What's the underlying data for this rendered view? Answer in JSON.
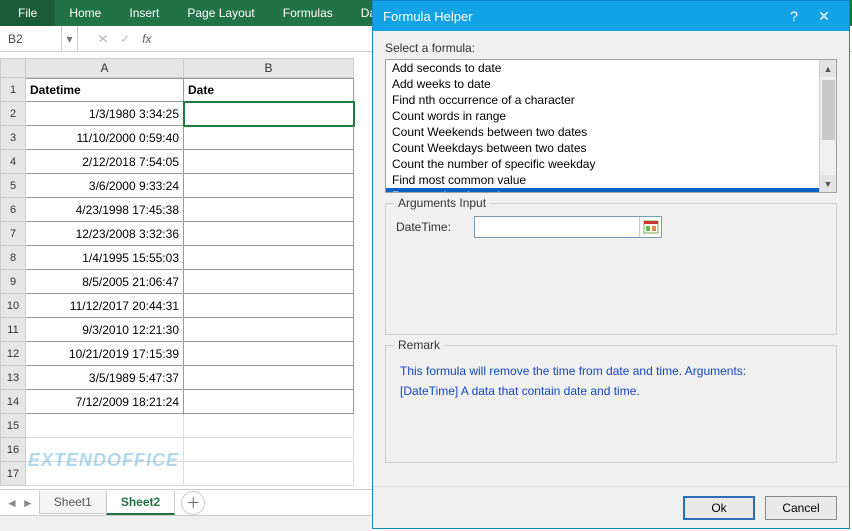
{
  "ribbon": {
    "tabs": [
      "File",
      "Home",
      "Insert",
      "Page Layout",
      "Formulas",
      "Data"
    ]
  },
  "namebox": {
    "value": "B2",
    "fx_label": "fx"
  },
  "columns": [
    "A",
    "B"
  ],
  "headers": {
    "A": "Datetime",
    "B": "Date"
  },
  "rows": [
    "1/3/1980 3:34:25",
    "11/10/2000 0:59:40",
    "2/12/2018 7:54:05",
    "3/6/2000 9:33:24",
    "4/23/1998 17:45:38",
    "12/23/2008 3:32:36",
    "1/4/1995 15:55:03",
    "8/5/2005 21:06:47",
    "11/12/2017 20:44:31",
    "9/3/2010 12:21:30",
    "10/21/2019 17:15:39",
    "3/5/1989 5:47:37",
    "7/12/2009 18:21:24"
  ],
  "blank_rows": [
    "15",
    "16",
    "17"
  ],
  "sheets": {
    "items": [
      "Sheet1",
      "Sheet2"
    ],
    "active": "Sheet2"
  },
  "watermark": "EXTENDOFFICE",
  "dialog": {
    "title": "Formula Helper",
    "help": "?",
    "close": "✕",
    "select_label": "Select a formula:",
    "formulas": [
      "Add seconds to date",
      "Add weeks to date",
      "Find nth occurrence of a character",
      "Count words in range",
      "Count Weekends between two dates",
      "Count Weekdays between two dates",
      "Count the number of specific weekday",
      "Find most common value",
      "Remove time from date"
    ],
    "selected_formula": "Remove time from date",
    "args_legend": "Arguments Input",
    "arg1_label": "DateTime:",
    "remark_legend": "Remark",
    "remark_line1": "This formula will remove the time from date and time. Arguments:",
    "remark_line2": "[DateTime] A data that contain date and time.",
    "ok": "Ok",
    "cancel": "Cancel"
  }
}
